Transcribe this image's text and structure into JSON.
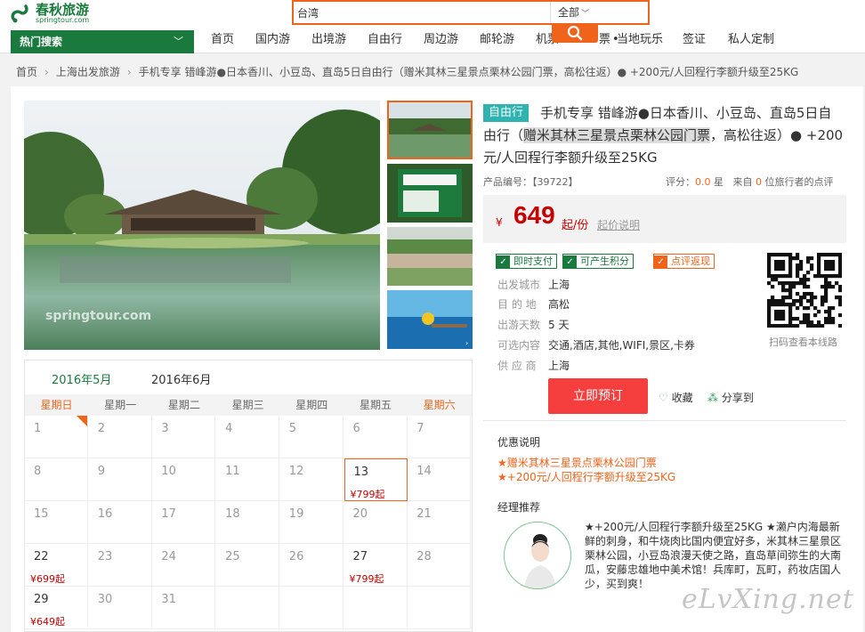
{
  "brand": {
    "name_cn": "春秋旅游",
    "name_en": "springtour.com"
  },
  "search": {
    "value": "台湾",
    "scope": "全部"
  },
  "nav": {
    "hot_search": "热门搜索",
    "items": [
      "首页",
      "国内游",
      "出境游",
      "自由行",
      "周边游",
      "邮轮游",
      "机票",
      "票",
      "当地玩乐",
      "签证",
      "私人定制"
    ]
  },
  "breadcrumb": {
    "home": "首页",
    "category": "上海出发旅游",
    "current": "手机专享 错峰游●日本香川、小豆岛、直岛5日自由行（赠米其林三星景点栗林公园门票，高松往返）● +200元/人回程行李额升级至25KG"
  },
  "product": {
    "tag": "自由行",
    "title_a": "手机专享 错峰游●日本香川、小豆岛、直岛5日自由行（",
    "title_hl": "赠米其林三星景点栗林公园门票",
    "title_b": "，高松往返）● +200元/人回程行李额升级至25KG",
    "code_label": "产品编号：",
    "code": "【39722】",
    "rating_label": "评分：",
    "rating": "0.0",
    "rating_unit": "星",
    "review_pre": "来自",
    "review_count": "0",
    "review_post": "位旅行者的点评"
  },
  "price": {
    "currency": "¥",
    "amount": "649",
    "unit": "起/份",
    "explain": "起价说明"
  },
  "badges": [
    "即时支付",
    "可产生积分",
    "点评返现"
  ],
  "info": [
    {
      "label": "出发城市",
      "value": "上海"
    },
    {
      "label": "目 的 地",
      "value": "高松"
    },
    {
      "label": "出游天数",
      "value": "5 天"
    },
    {
      "label": "可选内容",
      "value": "交通,酒店,其他,WIFI,景区,卡券"
    },
    {
      "label": "供 应 商",
      "value": "上海"
    }
  ],
  "qr": {
    "caption": "扫码查看本线路"
  },
  "actions": {
    "book": "立即预订",
    "favorite": "收藏",
    "share": "分享到"
  },
  "promo": {
    "title": "优惠说明",
    "items": [
      "★赠米其林三星景点栗林公园门票",
      "★+200元/人回程行李额升级至25KG"
    ]
  },
  "manager": {
    "title": "经理推荐",
    "text": "★+200元/人回程行李额升级至25KG ★濑户内海最新鲜的刺身，和牛烧肉比国内便宜好多，米其林三星景区栗林公园，小豆岛浪漫天使之路，直岛草间弥生的大南瓜，安藤忠雄地中美术馆！兵库町，瓦町，药妆店国人少，买到爽！"
  },
  "calendar": {
    "tabs": [
      "2016年5月",
      "2016年6月"
    ],
    "weekdays": [
      "星期日",
      "星期一",
      "星期二",
      "星期三",
      "星期四",
      "星期五",
      "星期六"
    ],
    "days": [
      {
        "d": "1",
        "p": ""
      },
      {
        "d": "2",
        "p": ""
      },
      {
        "d": "3",
        "p": ""
      },
      {
        "d": "4",
        "p": ""
      },
      {
        "d": "5",
        "p": ""
      },
      {
        "d": "6",
        "p": ""
      },
      {
        "d": "7",
        "p": ""
      },
      {
        "d": "8",
        "p": ""
      },
      {
        "d": "9",
        "p": ""
      },
      {
        "d": "10",
        "p": ""
      },
      {
        "d": "11",
        "p": ""
      },
      {
        "d": "12",
        "p": ""
      },
      {
        "d": "13",
        "p": "¥799起"
      },
      {
        "d": "14",
        "p": ""
      },
      {
        "d": "15",
        "p": ""
      },
      {
        "d": "16",
        "p": ""
      },
      {
        "d": "17",
        "p": ""
      },
      {
        "d": "18",
        "p": ""
      },
      {
        "d": "19",
        "p": ""
      },
      {
        "d": "20",
        "p": ""
      },
      {
        "d": "21",
        "p": ""
      },
      {
        "d": "22",
        "p": "¥699起"
      },
      {
        "d": "23",
        "p": ""
      },
      {
        "d": "24",
        "p": ""
      },
      {
        "d": "25",
        "p": ""
      },
      {
        "d": "26",
        "p": ""
      },
      {
        "d": "27",
        "p": "¥799起"
      },
      {
        "d": "28",
        "p": ""
      },
      {
        "d": "29",
        "p": "¥649起"
      },
      {
        "d": "30",
        "p": ""
      },
      {
        "d": "31",
        "p": ""
      },
      {
        "d": "",
        "p": ""
      },
      {
        "d": "",
        "p": ""
      },
      {
        "d": "",
        "p": ""
      },
      {
        "d": "",
        "p": ""
      }
    ]
  },
  "watermarks": {
    "photo": "springtour.com",
    "site": "eLvXing.net"
  },
  "colors": {
    "brand_green": "#1a7a3e",
    "accent_orange": "#f0631b",
    "price_red": "#c40000",
    "book_red": "#f53e3e",
    "teal_tag": "#2eb3b0"
  }
}
